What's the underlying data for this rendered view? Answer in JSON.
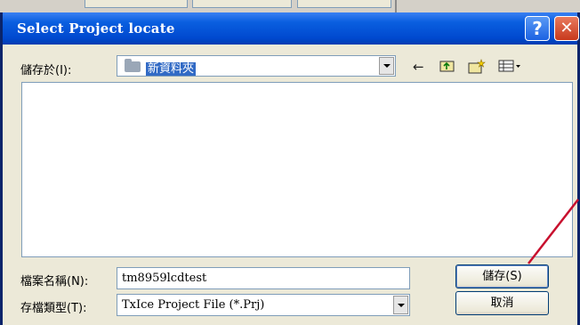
{
  "dialog": {
    "title": "Select Project locate",
    "help_glyph": "?",
    "close_glyph": "✕"
  },
  "save_in": {
    "label": "儲存於(I):",
    "value": "新資料夾"
  },
  "nav_icons": [
    "back-icon",
    "up-folder-icon",
    "new-folder-icon",
    "view-menu-icon"
  ],
  "file_name": {
    "label": "檔案名稱(N):",
    "value": "tm8959lcdtest"
  },
  "file_type": {
    "label": "存檔類型(T):",
    "value": "TxIce Project File (*.Prj)"
  },
  "buttons": {
    "save": "儲存(S)",
    "cancel": "取消"
  },
  "colors": {
    "titlebar": "#0049cf",
    "selection": "#316ac5",
    "annotation_arrow": "#c8102e"
  }
}
